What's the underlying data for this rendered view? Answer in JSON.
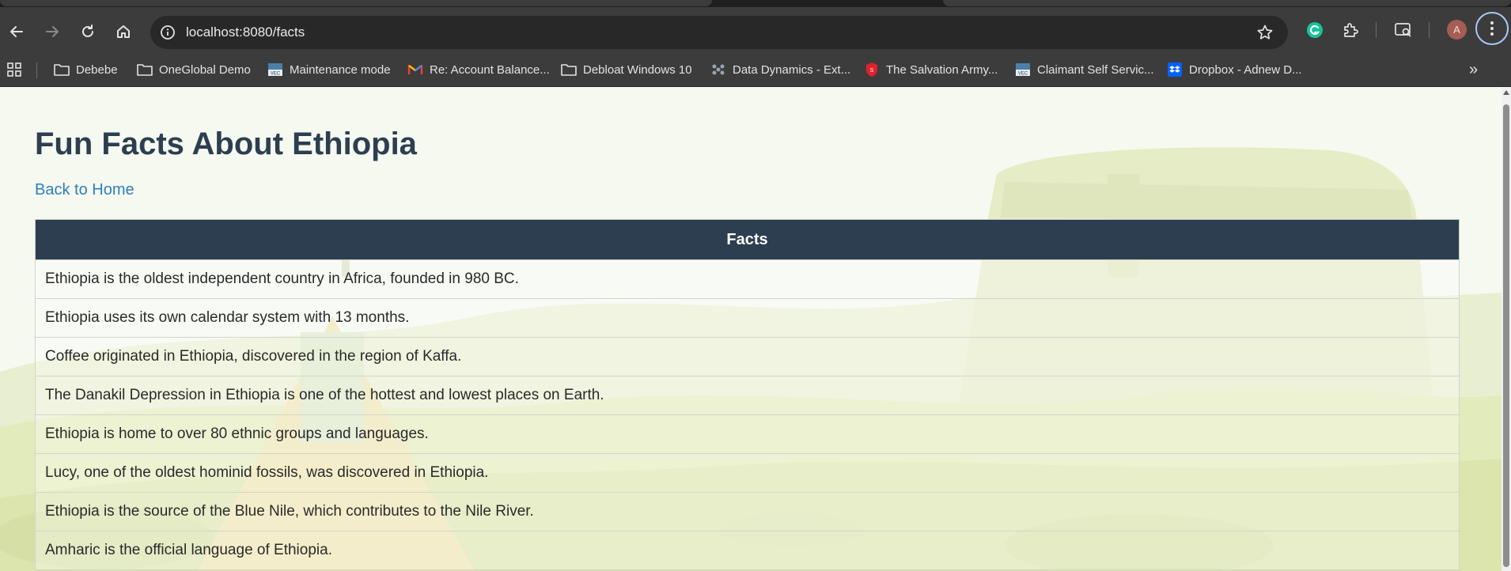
{
  "browser": {
    "url": "localhost:8080/facts",
    "profile_initial": "A",
    "bookmarks": [
      {
        "label": "Debebe",
        "icon": "folder-icon"
      },
      {
        "label": "OneGlobal Demo",
        "icon": "folder-icon"
      },
      {
        "label": "Maintenance mode",
        "icon": "vec-icon"
      },
      {
        "label": "Re: Account Balance...",
        "icon": "gmail-icon"
      },
      {
        "label": "Debloat Windows 10",
        "icon": "folder-icon"
      },
      {
        "label": "Data Dynamics - Ext...",
        "icon": "datadynamics-icon"
      },
      {
        "label": "The Salvation Army...",
        "icon": "salvation-army-icon"
      },
      {
        "label": "Claimant Self Servic...",
        "icon": "vec-icon"
      },
      {
        "label": "Dropbox - Adnew D...",
        "icon": "dropbox-icon"
      }
    ]
  },
  "page": {
    "title": "Fun Facts About Ethiopia",
    "back_link": "Back to Home",
    "table_header": "Facts",
    "facts": [
      "Ethiopia is the oldest independent country in Africa, founded in 980 BC.",
      "Ethiopia uses its own calendar system with 13 months.",
      "Coffee originated in Ethiopia, discovered in the region of Kaffa.",
      "The Danakil Depression in Ethiopia is one of the hottest and lowest places on Earth.",
      "Ethiopia is home to over 80 ethnic groups and languages.",
      "Lucy, one of the oldest hominid fossils, was discovered in Ethiopia.",
      "Ethiopia is the source of the Blue Nile, which contributes to the Nile River.",
      "Amharic is the official language of Ethiopia."
    ]
  },
  "colors": {
    "header_bg": "#2c3e50",
    "title": "#2c3e50",
    "link": "#2f7fbf",
    "chrome": "#3c3c3c"
  }
}
